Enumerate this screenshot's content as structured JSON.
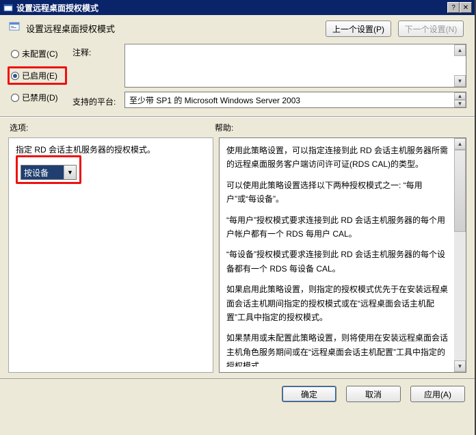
{
  "window": {
    "title": "设置远程桌面授权模式"
  },
  "header": {
    "page_title": "设置远程桌面授权模式",
    "prev_button": "上一个设置(P)",
    "next_button": "下一个设置(N)"
  },
  "radios": {
    "not_configured": "未配置(C)",
    "enabled": "已启用(E)",
    "disabled": "已禁用(D)",
    "selected": "enabled"
  },
  "fields": {
    "notes_label": "注释:",
    "notes_value": "",
    "platform_label": "支持的平台:",
    "platform_value": "至少带 SP1 的 Microsoft Windows Server 2003"
  },
  "section_labels": {
    "options": "选项:",
    "help": "帮助:"
  },
  "options": {
    "description": "指定 RD 会话主机服务器的授权模式。",
    "dropdown_value": "按设备"
  },
  "help": {
    "p1": "使用此策略设置，可以指定连接到此 RD 会话主机服务器所需的远程桌面服务客户端访问许可证(RDS CAL)的类型。",
    "p2": "可以使用此策略设置选择以下两种授权模式之一: “每用户”或“每设备”。",
    "p3": "“每用户”授权模式要求连接到此 RD 会话主机服务器的每个用户帐户都有一个 RDS 每用户 CAL。",
    "p4": "“每设备”授权模式要求连接到此 RD 会话主机服务器的每个设备都有一个 RDS 每设备 CAL。",
    "p5": "如果启用此策略设置，则指定的授权模式优先于在安装远程桌面会话主机期间指定的授权模式或在“远程桌面会话主机配置”工具中指定的授权模式。",
    "p6": "如果禁用或未配置此策略设置，则将使用在安装远程桌面会话主机角色服务期间或在“远程桌面会话主机配置”工具中指定的授权模式。"
  },
  "buttons": {
    "ok": "确定",
    "cancel": "取消",
    "apply": "应用(A)"
  }
}
